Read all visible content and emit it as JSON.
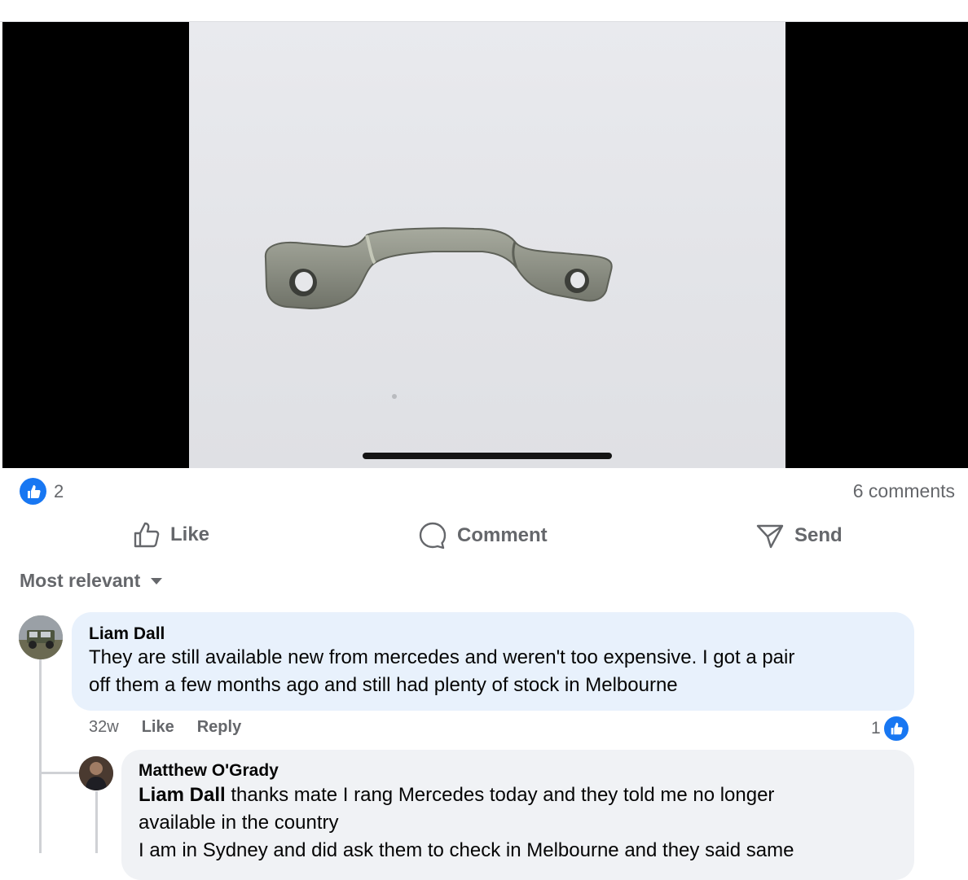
{
  "post": {
    "reaction_count": "2",
    "comments_count": "6 comments"
  },
  "actions": {
    "like": "Like",
    "comment": "Comment",
    "send": "Send"
  },
  "sort": {
    "label": "Most relevant"
  },
  "comments": [
    {
      "author": "Liam Dall",
      "text_line1": "They are still available new from mercedes and weren't too expensive. I got a pair",
      "text_line2": "off them a few months ago and still had plenty of stock in Melbourne",
      "time": "32w",
      "like_label": "Like",
      "reply_label": "Reply",
      "reaction_count": "1"
    }
  ],
  "reply": {
    "author": "Matthew O'Grady",
    "mention": "Liam Dall",
    "text_line1_rest": " thanks mate I rang Mercedes today and they told me no longer",
    "text_line2": "available in the country",
    "text_line3": "I am in Sydney and did ask them to check in Melbourne and they said same"
  },
  "colors": {
    "accent": "#1877f2",
    "secondary_text": "#65676b",
    "comment_bubble": "#e8f1fc",
    "reply_bubble": "#f0f2f5"
  },
  "icons": [
    "like-thumb-icon",
    "comment-bubble-icon",
    "send-icon",
    "sort-caret-icon"
  ]
}
